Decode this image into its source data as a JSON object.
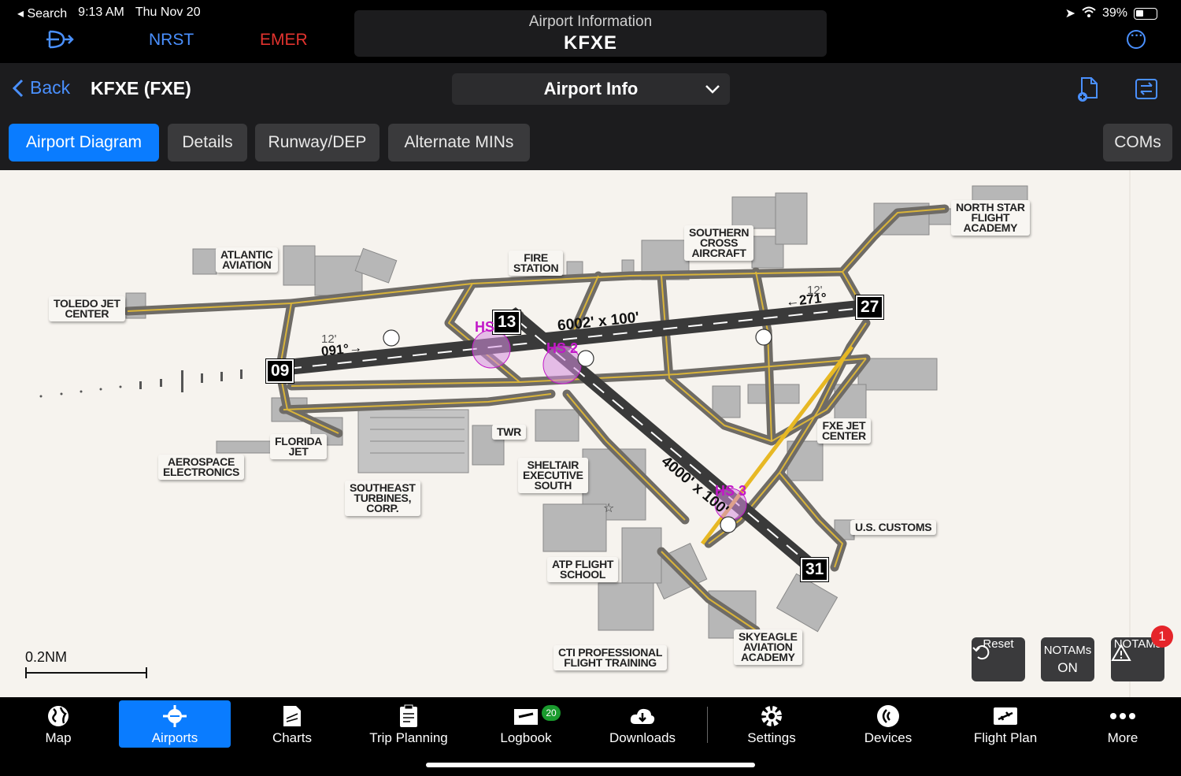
{
  "status": {
    "back_app": "◂ Search",
    "time": "9:13 AM",
    "date": "Thu Nov 20",
    "battery": "39%"
  },
  "topnav": {
    "nrst": "NRST",
    "emer": "EMER",
    "title": "Airport Information",
    "ident": "KFXE"
  },
  "header": {
    "back": "Back",
    "airport": "KFXE (FXE)",
    "dropdown": "Airport Info"
  },
  "tabs": [
    "Airport Diagram",
    "Details",
    "Runway/DEP",
    "Alternate MINs",
    "COMs"
  ],
  "map": {
    "labels": {
      "toledo": "TOLEDO JET\nCENTER",
      "atlantic": "ATLANTIC\nAVIATION",
      "fire": "FIRE\nSTATION",
      "southern": "SOUTHERN\nCROSS\nAIRCRAFT",
      "northstar": "NORTH STAR\nFLIGHT\nACADEMY",
      "aerospace": "AEROSPACE\nELECTRONICS",
      "florida": "FLORIDA\nJET",
      "southeast": "SOUTHEAST\nTURBINES,\nCORP.",
      "twr": "TWR",
      "sheltair": "SHELTAIR\nEXECUTIVE\nSOUTH",
      "fxejet": "FXE JET\nCENTER",
      "customs": "U.S. CUSTOMS",
      "atp": "ATP FLIGHT\nSCHOOL",
      "cti": "CTI PROFESSIONAL\nFLIGHT TRAINING",
      "skyeagle": "SKYEAGLE\nAVIATION\nACADEMY"
    },
    "runways": {
      "r09": "09",
      "r27": "27",
      "r13": "13",
      "r31": "31",
      "len1": "6002' x 100'",
      "len2": "4000' x 100'",
      "hdg1": "091°→",
      "hdg2": "←271°",
      "elev1": "12'",
      "elev2": "12'"
    },
    "hotspots": [
      "HS",
      "HS 2",
      "HS 3"
    ],
    "scale": "0.2NM",
    "buttons": {
      "reset": "Reset",
      "notams_label": "NOTAMs",
      "notams_state": "ON",
      "notams": "NOTAMs",
      "notams_count": "1"
    }
  },
  "bottom_nav": {
    "items": [
      "Map",
      "Airports",
      "Charts",
      "Trip Planning",
      "Logbook",
      "Downloads",
      "Settings",
      "Devices",
      "Flight Plan",
      "More"
    ],
    "logbook_badge": "20"
  },
  "colors": {
    "accent": "#0a7cff",
    "emer": "#e2332e",
    "taxiway": "#d9b43a",
    "hotspot": "#c218c8"
  }
}
